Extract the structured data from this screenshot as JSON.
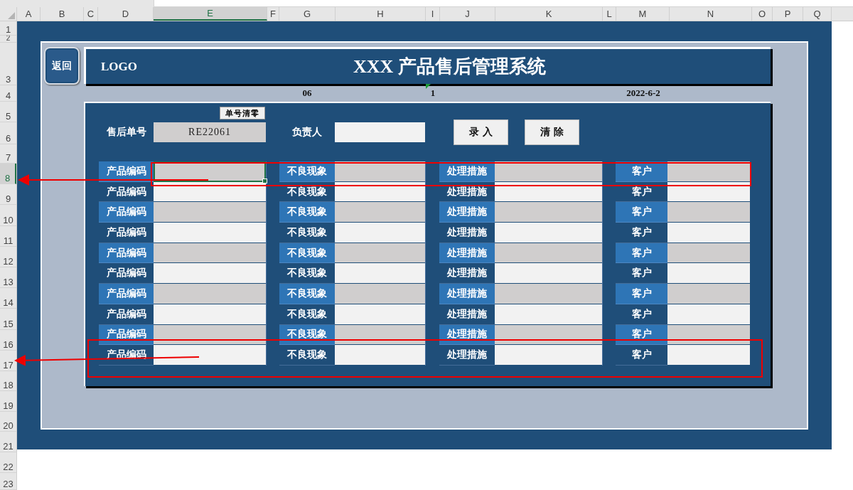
{
  "sheet": {
    "columns": [
      {
        "label": "A",
        "selected": false
      },
      {
        "label": "B",
        "selected": false
      },
      {
        "label": "C",
        "selected": false
      },
      {
        "label": "D",
        "selected": false
      },
      {
        "label": "E",
        "selected": true
      },
      {
        "label": "F",
        "selected": false
      },
      {
        "label": "G",
        "selected": false
      },
      {
        "label": "H",
        "selected": false
      },
      {
        "label": "I",
        "selected": false
      },
      {
        "label": "J",
        "selected": false
      },
      {
        "label": "K",
        "selected": false
      },
      {
        "label": "L",
        "selected": false
      },
      {
        "label": "M",
        "selected": false
      },
      {
        "label": "N",
        "selected": false
      },
      {
        "label": "O",
        "selected": false
      },
      {
        "label": "P",
        "selected": false
      },
      {
        "label": "Q",
        "selected": false
      }
    ],
    "rows": [
      {
        "label": "1",
        "selected": false
      },
      {
        "label": "2",
        "selected": false
      },
      {
        "label": "3",
        "selected": false
      },
      {
        "label": "4",
        "selected": false
      },
      {
        "label": "5",
        "selected": false
      },
      {
        "label": "6",
        "selected": false
      },
      {
        "label": "7",
        "selected": false
      },
      {
        "label": "8",
        "selected": true
      },
      {
        "label": "9",
        "selected": false
      },
      {
        "label": "10",
        "selected": false
      },
      {
        "label": "11",
        "selected": false
      },
      {
        "label": "12",
        "selected": false
      },
      {
        "label": "13",
        "selected": false
      },
      {
        "label": "14",
        "selected": false
      },
      {
        "label": "15",
        "selected": false
      },
      {
        "label": "16",
        "selected": false
      },
      {
        "label": "17",
        "selected": false
      },
      {
        "label": "18",
        "selected": false
      },
      {
        "label": "19",
        "selected": false
      },
      {
        "label": "20",
        "selected": false
      },
      {
        "label": "21",
        "selected": false
      },
      {
        "label": "22",
        "selected": false
      },
      {
        "label": "23",
        "selected": false
      }
    ]
  },
  "back_button": "返回",
  "header": {
    "logo": "LOGO",
    "title": "XXX 产品售后管理系统"
  },
  "info": [
    "06",
    "1",
    "2022-6-2"
  ],
  "form": {
    "clear_number_button": "单号清零",
    "order_label": "售后单号",
    "order_value": "RE22061",
    "owner_label": "负责人",
    "buttons": [
      "录入",
      "清除"
    ]
  },
  "table": {
    "rows": [
      {
        "kind": "accent",
        "selected": true,
        "labels": [
          "产品编码",
          "不良现象",
          "处理措施",
          "客户"
        ]
      },
      {
        "kind": "plain",
        "selected": false,
        "labels": [
          "产品编码",
          "不良现象",
          "处理措施",
          "客户"
        ]
      },
      {
        "kind": "accent",
        "selected": false,
        "labels": [
          "产品编码",
          "不良现象",
          "处理措施",
          "客户"
        ]
      },
      {
        "kind": "plain",
        "selected": false,
        "labels": [
          "产品编码",
          "不良现象",
          "处理措施",
          "客户"
        ]
      },
      {
        "kind": "accent",
        "selected": false,
        "labels": [
          "产品编码",
          "不良现象",
          "处理措施",
          "客户"
        ]
      },
      {
        "kind": "plain",
        "selected": false,
        "labels": [
          "产品编码",
          "不良现象",
          "处理措施",
          "客户"
        ]
      },
      {
        "kind": "accent",
        "selected": false,
        "labels": [
          "产品编码",
          "不良现象",
          "处理措施",
          "客户"
        ]
      },
      {
        "kind": "plain",
        "selected": false,
        "labels": [
          "产品编码",
          "不良现象",
          "处理措施",
          "客户"
        ]
      },
      {
        "kind": "accent",
        "selected": false,
        "labels": [
          "产品编码",
          "不良现象",
          "处理措施",
          "客户"
        ]
      },
      {
        "kind": "plain",
        "selected": false,
        "labels": [
          "产品编码",
          "不良现象",
          "处理措施",
          "客户"
        ]
      }
    ]
  }
}
